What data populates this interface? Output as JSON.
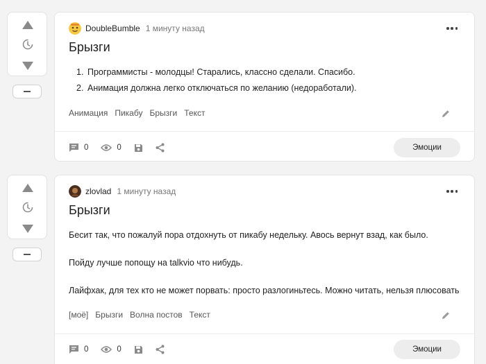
{
  "posts": [
    {
      "author": "DoubleBumble",
      "time": "1 минуту назад",
      "title": "Брызги",
      "list": [
        "Программисты - молодцы! Старались, классно сделали. Спасибо.",
        "Анимация должна легко отключаться по желанию (недоработали)."
      ],
      "tags": [
        "Анимация",
        "Пикабу",
        "Брызги",
        "Текст"
      ],
      "comments": "0",
      "views": "0",
      "emotions_label": "Эмоции"
    },
    {
      "author": "zlovlad",
      "time": "1 минуту назад",
      "title": "Брызги",
      "paragraphs": [
        "Бесит так, что пожалуй пора отдохнуть от пикабу недельку. Авось вернут взад, как было.",
        "Пойду лучше попощу на talkvio что нибудь.",
        "Лайфхак, для тех кто не может порвать: просто разлогиньтесь. Можно читать, нельзя плюсовать"
      ],
      "tags": [
        "[моё]",
        "Брызги",
        "Волна постов",
        "Текст"
      ],
      "comments": "0",
      "views": "0",
      "emotions_label": "Эмоции"
    }
  ],
  "icons": {
    "vote_up": "triangle-up-icon",
    "vote_later": "clock-icon",
    "vote_down": "triangle-down-icon",
    "minus": "minus-icon",
    "more": "more-dots-icon",
    "edit": "pencil-icon",
    "comments": "comment-icon",
    "views": "eye-icon",
    "save": "floppy-disk-icon",
    "share": "share-icon"
  },
  "colors": {
    "background": "#f3f3f3",
    "card": "#ffffff",
    "icon": "#8a8a8a",
    "button": "#ededed"
  }
}
